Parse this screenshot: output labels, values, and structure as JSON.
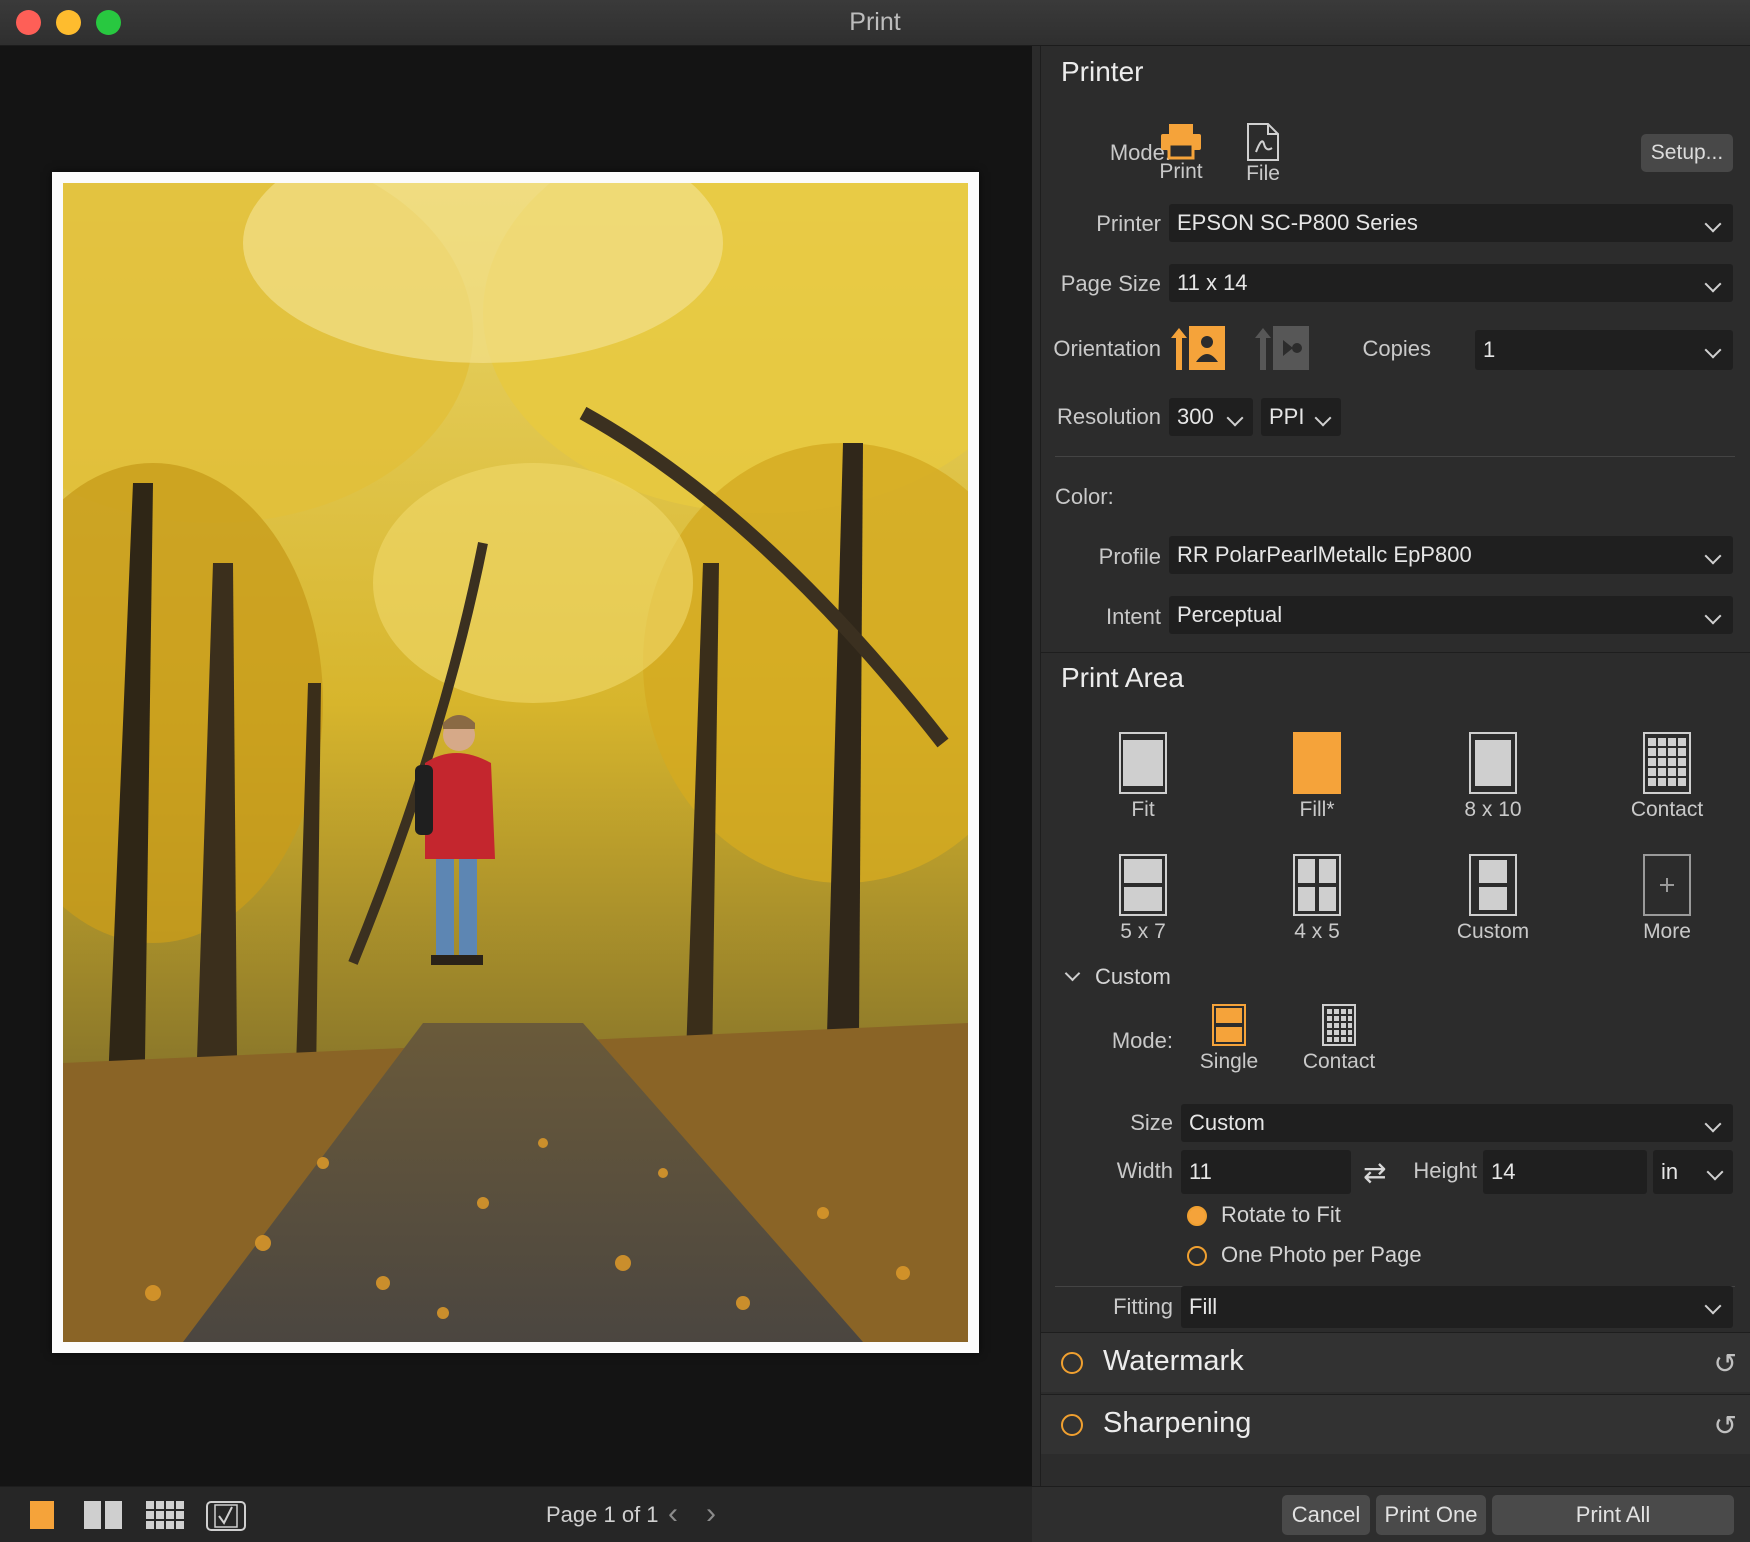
{
  "window": {
    "title": "Print"
  },
  "printer": {
    "section_title": "Printer",
    "mode_label": "Mode:",
    "mode_print": "Print",
    "mode_file": "File",
    "setup": "Setup...",
    "printer_label": "Printer",
    "printer_value": "EPSON SC-P800 Series",
    "page_size_label": "Page Size",
    "page_size_value": "11 x 14",
    "orientation_label": "Orientation",
    "copies_label": "Copies",
    "copies_value": "1",
    "resolution_label": "Resolution",
    "resolution_value": "300",
    "resolution_unit": "PPI"
  },
  "color": {
    "label": "Color:",
    "profile_label": "Profile",
    "profile_value": "RR PolarPearlMetallc EpP800",
    "intent_label": "Intent",
    "intent_value": "Perceptual"
  },
  "print_area": {
    "section_title": "Print Area",
    "tiles": [
      "Fit",
      "Fill*",
      "8 x 10",
      "Contact",
      "5 x 7",
      "4 x 5",
      "Custom",
      "More"
    ],
    "selected": "Fill*",
    "custom_header": "Custom",
    "mode_label": "Mode:",
    "mode_single": "Single",
    "mode_contact": "Contact",
    "size_label": "Size",
    "size_value": "Custom",
    "width_label": "Width",
    "width_value": "11",
    "height_label": "Height",
    "height_value": "14",
    "unit_value": "in",
    "rotate_to_fit": "Rotate to Fit",
    "one_photo_per_page": "One Photo per Page",
    "rotate_to_fit_selected": true,
    "fitting_label": "Fitting",
    "fitting_value": "Fill"
  },
  "accordions": {
    "watermark": "Watermark",
    "sharpening": "Sharpening"
  },
  "footer": {
    "page_label": "Page 1 of 1",
    "cancel": "Cancel",
    "print_one": "Print One",
    "print_all": "Print All"
  },
  "colors": {
    "accent": "#f5a33a",
    "panel_bg": "#2c2c2c",
    "field_bg": "#1f1f1f",
    "preview_bg": "#141414"
  }
}
